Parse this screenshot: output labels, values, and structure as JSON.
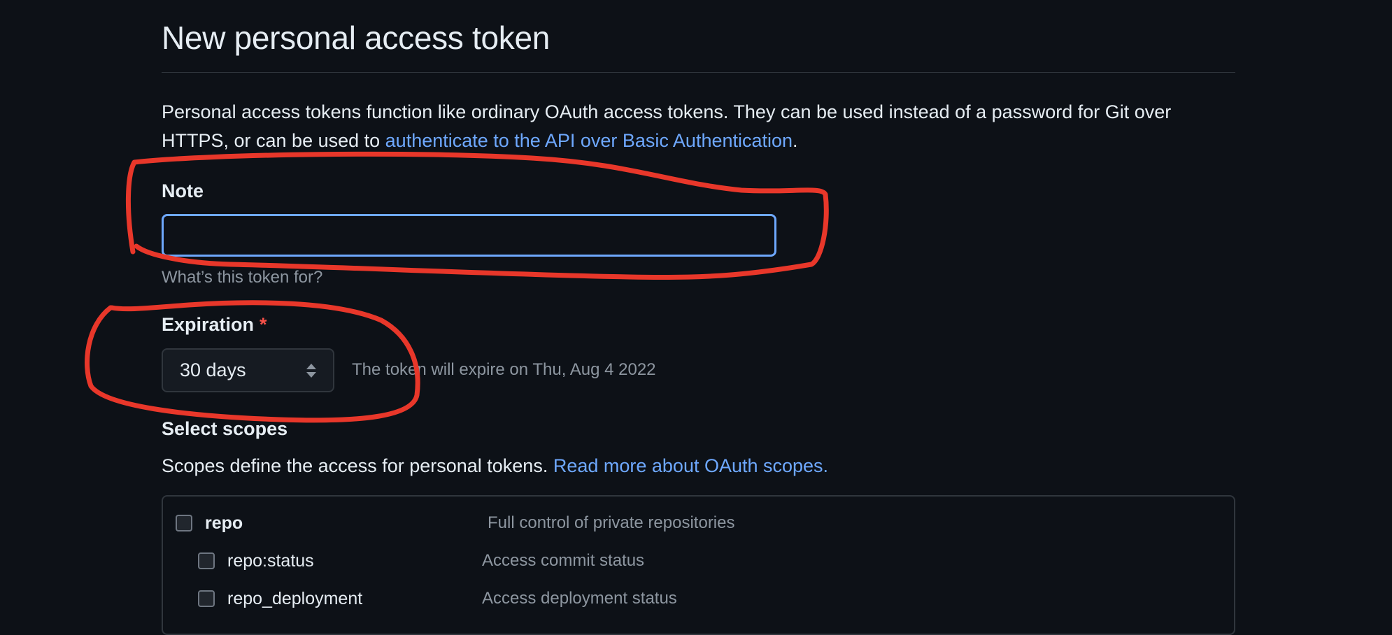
{
  "page": {
    "title": "New personal access token",
    "intro_text": "Personal access tokens function like ordinary OAuth access tokens. They can be used instead of a password for Git over HTTPS, or can be used to ",
    "intro_link": "authenticate to the API over Basic Authentication",
    "intro_end": "."
  },
  "note": {
    "label": "Note",
    "value": "",
    "placeholder": "",
    "help": "What’s this token for?"
  },
  "expiration": {
    "label": "Expiration",
    "required_marker": "*",
    "selected": "30 days",
    "hint": "The token will expire on Thu, Aug 4 2022"
  },
  "scopes": {
    "label": "Select scopes",
    "description": "Scopes define the access for personal tokens. ",
    "description_link": "Read more about OAuth scopes.",
    "items": [
      {
        "name": "repo",
        "description": "Full control of private repositories",
        "checked": false
      },
      {
        "name": "repo:status",
        "description": "Access commit status",
        "checked": false
      },
      {
        "name": "repo_deployment",
        "description": "Access deployment status",
        "checked": false
      }
    ]
  },
  "colors": {
    "background": "#0d1117",
    "link": "#6ea8fe",
    "focus_border": "#6ea8fe",
    "annotation": "#e8372a",
    "required": "#f85149"
  }
}
